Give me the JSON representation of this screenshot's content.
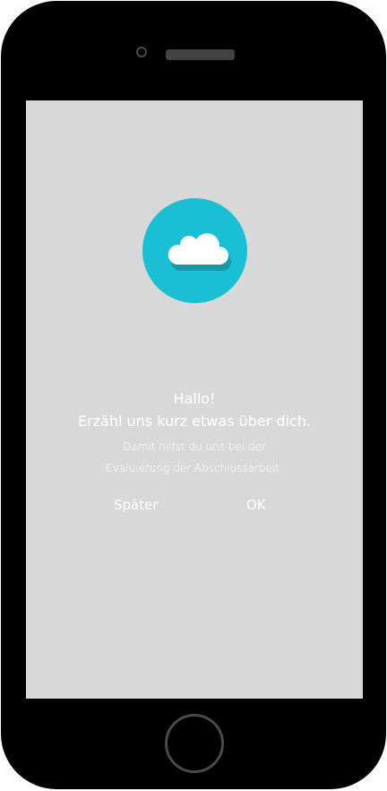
{
  "dialog": {
    "title": "Hallo!",
    "subtitle": "Erzähl uns kurz etwas über dich.",
    "description_line1": "Damit hilfst du uns bei der",
    "description_line2": "Evaluierung der Abschlussarbeit.",
    "later_label": "Später",
    "ok_label": "OK",
    "icon": "cloud-icon"
  },
  "colors": {
    "screen_background": "#d8d8d8",
    "badge": "#19bfd3",
    "text": "#ffffff",
    "phone_frame": "#000000"
  }
}
